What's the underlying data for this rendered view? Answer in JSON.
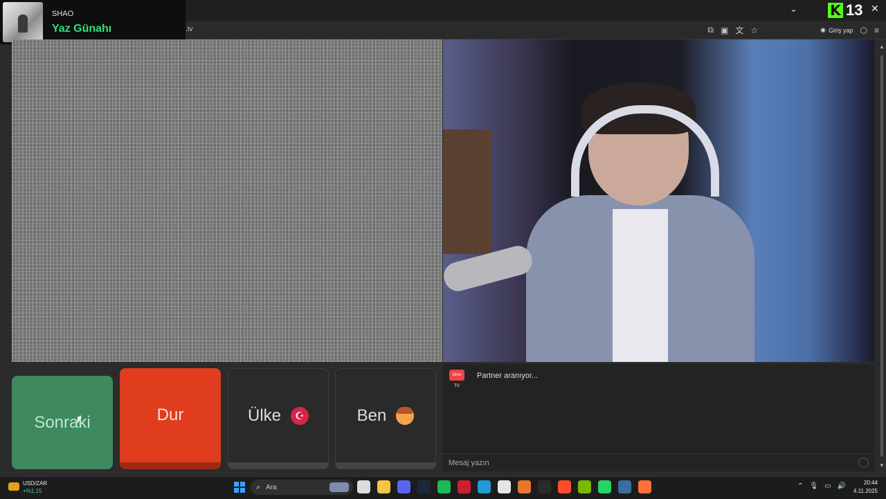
{
  "now_playing": {
    "artist": "SHAO",
    "title": "Yaz Günahı"
  },
  "browser": {
    "url_fragment": ".tv",
    "login_label": "Giriş yap",
    "kick_number": "13"
  },
  "buttons": {
    "next_label": "Sonraki",
    "stop_label": "Dur",
    "country_label": "Ülke",
    "country_flag": "☪",
    "me_label": "Ben"
  },
  "chat": {
    "logo_text": "Ome TV",
    "status": "Partner aranıyor...",
    "input_placeholder": "Mesaj yazın"
  },
  "taskbar": {
    "widget_title": "USD/ZAR",
    "widget_change": "+%1,15",
    "search_placeholder": "Ara",
    "apps": [
      {
        "name": "file-explorer-icon",
        "color": "#dcdcdc"
      },
      {
        "name": "folder-icon",
        "color": "#f4c542"
      },
      {
        "name": "discord-icon",
        "color": "#5865f2"
      },
      {
        "name": "steam-icon",
        "color": "#1b2838"
      },
      {
        "name": "spotify-icon",
        "color": "#1db954"
      },
      {
        "name": "opera-icon",
        "color": "#cc1f2f"
      },
      {
        "name": "edge-icon",
        "color": "#1f9ad6"
      },
      {
        "name": "chrome-icon",
        "color": "#e5e5e5"
      },
      {
        "name": "app-orange-icon",
        "color": "#e8772a"
      },
      {
        "name": "epic-games-icon",
        "color": "#2a2a2a"
      },
      {
        "name": "app-red-icon",
        "color": "#ff4b2b"
      },
      {
        "name": "nvidia-icon",
        "color": "#76b900"
      },
      {
        "name": "whatsapp-icon",
        "color": "#25d366"
      },
      {
        "name": "steam-2-icon",
        "color": "#3b6e9e"
      },
      {
        "name": "firefox-icon",
        "color": "#ff7139"
      }
    ],
    "time": "20:44",
    "date": "4.11.2025"
  }
}
